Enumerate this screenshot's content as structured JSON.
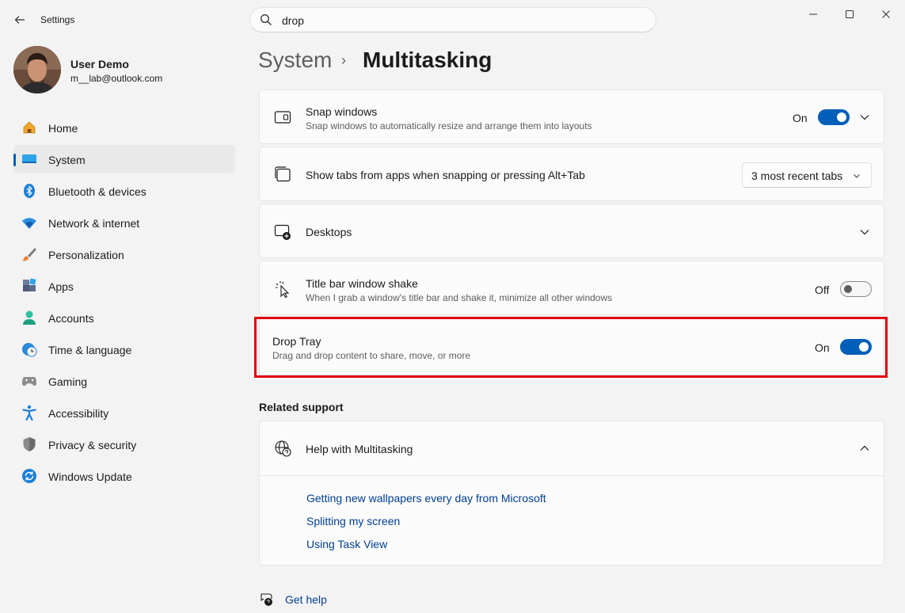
{
  "window": {
    "app_title": "Settings",
    "search_value": "drop"
  },
  "profile": {
    "name": "User Demo",
    "email": "m__lab@outlook.com"
  },
  "sidebar": {
    "items": [
      {
        "label": "Home",
        "icon": "home-icon"
      },
      {
        "label": "System",
        "icon": "system-icon",
        "active": true
      },
      {
        "label": "Bluetooth & devices",
        "icon": "bluetooth-icon"
      },
      {
        "label": "Network & internet",
        "icon": "wifi-icon"
      },
      {
        "label": "Personalization",
        "icon": "brush-icon"
      },
      {
        "label": "Apps",
        "icon": "apps-icon"
      },
      {
        "label": "Accounts",
        "icon": "account-icon"
      },
      {
        "label": "Time & language",
        "icon": "clock-globe-icon"
      },
      {
        "label": "Gaming",
        "icon": "gamepad-icon"
      },
      {
        "label": "Accessibility",
        "icon": "accessibility-icon"
      },
      {
        "label": "Privacy & security",
        "icon": "shield-icon"
      },
      {
        "label": "Windows Update",
        "icon": "update-icon"
      }
    ]
  },
  "breadcrumb": {
    "parent": "System",
    "separator": "›",
    "current": "Multitasking"
  },
  "settings": {
    "snap": {
      "title": "Snap windows",
      "desc": "Snap windows to automatically resize and arrange them into layouts",
      "state": "On"
    },
    "tabs": {
      "title": "Show tabs from apps when snapping or pressing Alt+Tab",
      "selected": "3 most recent tabs"
    },
    "desktops": {
      "title": "Desktops"
    },
    "shake": {
      "title": "Title bar window shake",
      "desc": "When I grab a window's title bar and shake it, minimize all other windows",
      "state": "Off"
    },
    "drop_tray": {
      "title": "Drop Tray",
      "desc": "Drag and drop content to share, move, or more",
      "state": "On"
    }
  },
  "related": {
    "title": "Related support",
    "help_title": "Help with Multitasking",
    "links": [
      "Getting new wallpapers every day from Microsoft",
      "Splitting my screen",
      "Using Task View"
    ]
  },
  "footer": {
    "get_help": "Get help"
  },
  "colors": {
    "accent": "#005fb8",
    "highlight": "#e0000f",
    "link": "#003e92"
  }
}
